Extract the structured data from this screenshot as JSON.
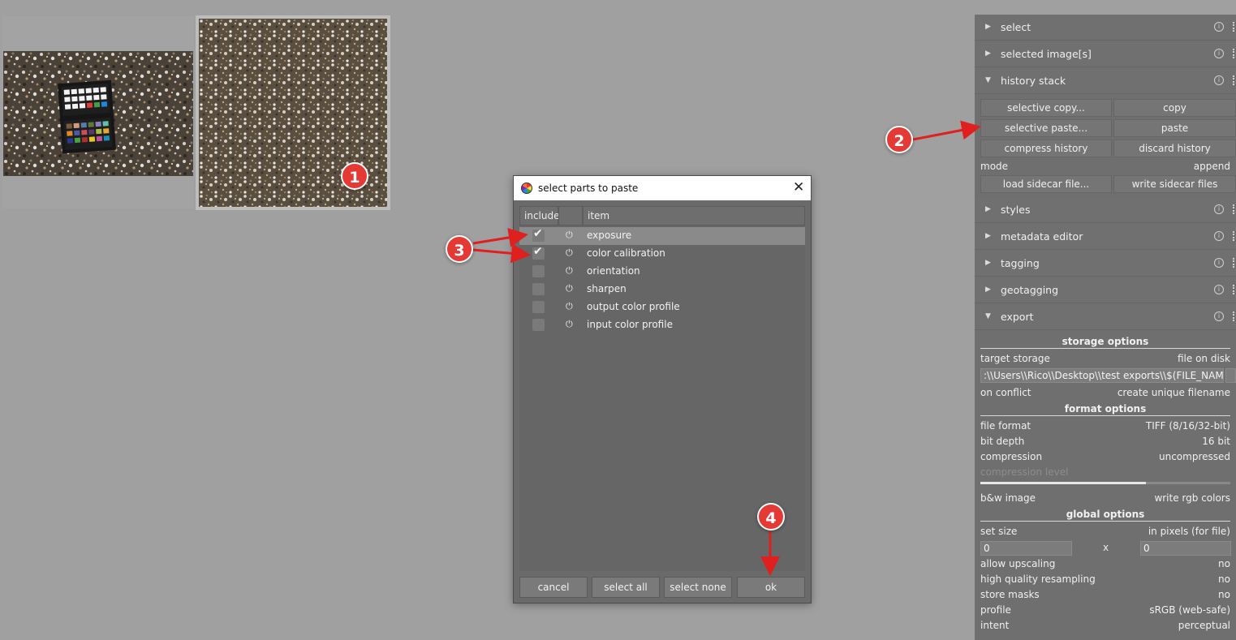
{
  "dialog": {
    "title": "select parts to paste",
    "columns": [
      "include",
      "",
      "item"
    ],
    "items": [
      {
        "label": "exposure",
        "checked": true
      },
      {
        "label": "color calibration",
        "checked": true
      },
      {
        "label": "orientation",
        "checked": false
      },
      {
        "label": "sharpen",
        "checked": false
      },
      {
        "label": "output color profile",
        "checked": false
      },
      {
        "label": "input color profile",
        "checked": false
      }
    ],
    "buttons": {
      "cancel": "cancel",
      "select_all": "select all",
      "select_none": "select none",
      "ok": "ok"
    }
  },
  "panel": {
    "modules": {
      "select": "select",
      "selected_images": "selected image[s]",
      "history_stack": "history stack",
      "styles": "styles",
      "metadata_editor": "metadata editor",
      "tagging": "tagging",
      "geotagging": "geotagging",
      "export": "export"
    },
    "history": {
      "selective_copy": "selective copy...",
      "copy": "copy",
      "selective_paste": "selective paste...",
      "paste": "paste",
      "compress_history": "compress history",
      "discard_history": "discard history",
      "mode_label": "mode",
      "mode_value": "append",
      "load_sidecar": "load sidecar file...",
      "write_sidecar": "write sidecar files"
    },
    "export": {
      "storage_options": "storage options",
      "target_storage_label": "target storage",
      "target_storage_value": "file on disk",
      "path": ":\\\\Users\\\\Rico\\\\Desktop\\\\test exports\\\\$(FILE_NAME)",
      "on_conflict_label": "on conflict",
      "on_conflict_value": "create unique filename",
      "format_options": "format options",
      "file_format_label": "file format",
      "file_format_value": "TIFF (8/16/32-bit)",
      "bit_depth_label": "bit depth",
      "bit_depth_value": "16 bit",
      "compression_label": "compression",
      "compression_value": "uncompressed",
      "compression_level_label": "compression level",
      "bw_image_label": "b&w image",
      "bw_image_value": "write rgb colors",
      "global_options": "global options",
      "set_size_label": "set size",
      "set_size_value": "in pixels (for file)",
      "width": "0",
      "x": "x",
      "height": "0",
      "allow_upscaling_label": "allow upscaling",
      "allow_upscaling_value": "no",
      "hq_resampling_label": "high quality resampling",
      "hq_resampling_value": "no",
      "store_masks_label": "store masks",
      "store_masks_value": "no",
      "profile_label": "profile",
      "profile_value": "sRGB (web-safe)",
      "intent_label": "intent",
      "intent_value": "perceptual"
    }
  },
  "markers": [
    "1",
    "2",
    "3",
    "4"
  ],
  "colors": {
    "marker": "#e53935",
    "panel": "#6f6f6f",
    "background": "#a0a0a0"
  }
}
